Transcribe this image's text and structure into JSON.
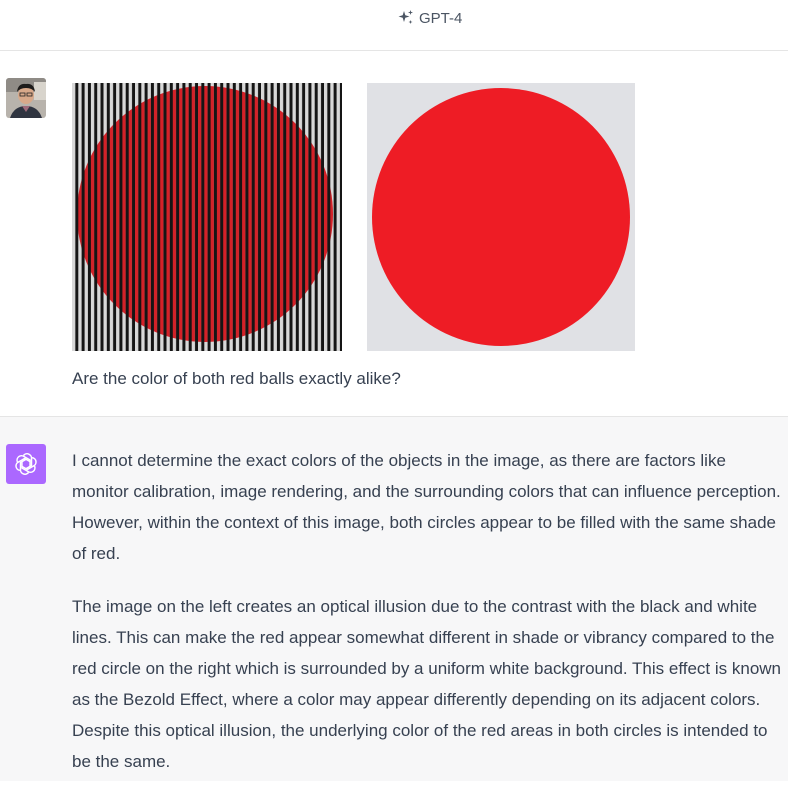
{
  "header": {
    "model_name": "GPT-4",
    "model_icon": "sparkle-icon"
  },
  "user_message": {
    "avatar": "user-photo-avatar",
    "images": [
      "red-circle-with-black-stripes",
      "red-circle-on-gray"
    ],
    "text": "Are the color of both red balls exactly alike?"
  },
  "assistant_message": {
    "avatar": "openai-logo-icon",
    "paragraphs": [
      "I cannot determine the exact colors of the objects in the image, as there are factors like monitor calibration, image rendering, and the surrounding colors that can influence perception. However, within the context of this image, both circles appear to be filled with the same shade of red.",
      "The image on the left creates an optical illusion due to the contrast with the black and white lines. This can make the red appear somewhat different in shade or vibrancy compared to the red circle on the right which is surrounded by a uniform white background. This effect is known as the Bezold Effect, where a color may appear differently depending on its adjacent colors. Despite this optical illusion, the underlying color of the red areas in both circles is intended to be the same."
    ]
  },
  "colors": {
    "assistant_bg": "#f7f7f8",
    "gpt_avatar": "#ab68ff",
    "circle_red": "#ee1c25",
    "plain_image_bg": "#e0e1e5"
  }
}
